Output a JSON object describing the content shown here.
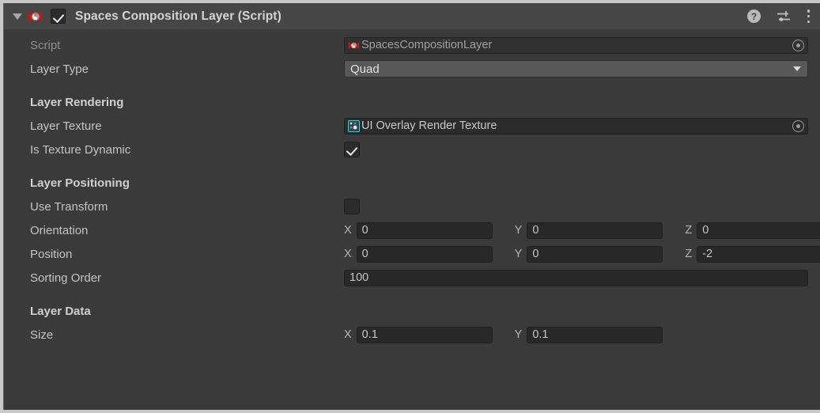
{
  "component": {
    "title": "Spaces Composition Layer (Script)",
    "enabled": true,
    "expanded": true,
    "icons": {
      "foldout": "triangle-down-icon",
      "script": "unity-script-icon",
      "help": "?",
      "preset": "preset-icon",
      "menu": "kebab-menu-icon"
    }
  },
  "fields": {
    "script": {
      "label": "Script",
      "value": "SpacesCompositionLayer",
      "icon": "cs-script-icon",
      "picker": "object-picker-icon",
      "disabled": true
    },
    "layer_type": {
      "label": "Layer Type",
      "value": "Quad",
      "arrow": "chevron-down-icon"
    }
  },
  "sections": [
    {
      "title": "Layer Rendering",
      "rows": [
        {
          "label": "Layer Texture",
          "type": "object",
          "value": "UI Overlay Render Texture",
          "icon": "render-texture-icon",
          "picker": "object-picker-icon"
        },
        {
          "label": "Is Texture Dynamic",
          "type": "checkbox",
          "checked": true
        }
      ]
    },
    {
      "title": "Layer Positioning",
      "rows": [
        {
          "label": "Use Transform",
          "type": "checkbox",
          "checked": false
        },
        {
          "label": "Orientation",
          "type": "vector3",
          "axes": [
            "X",
            "Y",
            "Z"
          ],
          "values": [
            "0",
            "0",
            "0"
          ]
        },
        {
          "label": "Position",
          "type": "vector3",
          "axes": [
            "X",
            "Y",
            "Z"
          ],
          "values": [
            "0",
            "0",
            "-2"
          ]
        },
        {
          "label": "Sorting Order",
          "type": "number",
          "value": "100"
        }
      ]
    },
    {
      "title": "Layer Data",
      "rows": [
        {
          "label": "Size",
          "type": "vector2",
          "axes": [
            "X",
            "Y"
          ],
          "values": [
            "0.1",
            "0.1"
          ]
        }
      ]
    }
  ],
  "colors": {
    "panel_bg": "#3a3a3a",
    "header_bg": "#464646",
    "input_bg": "#282828",
    "dropdown_bg": "#585858",
    "label": "#c4c4c4",
    "label_dim": "#8e8e8e",
    "script_icon_red": "#c0241f",
    "texture_icon_cyan": "#5ec8d8"
  }
}
